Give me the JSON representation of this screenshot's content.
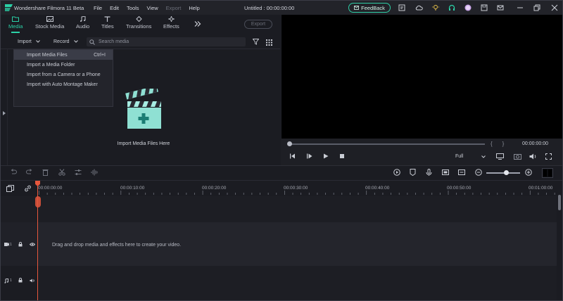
{
  "titlebar": {
    "app_title": "Wondershare Filmora 11 Beta",
    "menu": [
      "File",
      "Edit",
      "Tools",
      "View",
      "Export",
      "Help"
    ],
    "doc_title": "Untitled : 00:00:00:00",
    "feedback_label": "FeedBack"
  },
  "nav": {
    "tabs": [
      "Media",
      "Stock Media",
      "Audio",
      "Titles",
      "Transitions",
      "Effects"
    ],
    "export_label": "Export"
  },
  "media_toolbar": {
    "import_label": "Import",
    "record_label": "Record",
    "search_placeholder": "Search media"
  },
  "import_menu": {
    "items": [
      {
        "label": "Import Media Files",
        "shortcut": "Ctrl+I"
      },
      {
        "label": "Import a Media Folder",
        "shortcut": ""
      },
      {
        "label": "Import from a Camera or a Phone",
        "shortcut": ""
      },
      {
        "label": "Import with Auto Montage Maker",
        "shortcut": ""
      }
    ]
  },
  "library": {
    "import_here": "Import Media Files Here"
  },
  "preview": {
    "time": "00:00:00:00",
    "bracket_in": "{",
    "bracket_out": "}",
    "quality": "Full"
  },
  "timeline": {
    "ruler_labels": [
      "00:00:00:00",
      "00:00:10:00",
      "00:00:20:00",
      "00:00:30:00",
      "00:00:40:00",
      "00:00:50:00",
      "00:01:00:00"
    ],
    "drop_hint": "Drag and drop media and effects here to create your video.",
    "video_track_num": "1",
    "audio_track_num": "1",
    "zoom_level": 0.6
  },
  "colors": {
    "accent": "#2bd1a7",
    "playhead": "#e6573d",
    "bg": "#1b1c22"
  }
}
